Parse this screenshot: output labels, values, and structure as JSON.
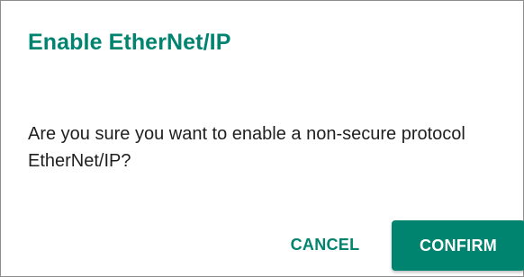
{
  "dialog": {
    "title": "Enable EtherNet/IP",
    "message": "Are you sure you want to enable a non-secure protocol EtherNet/IP?",
    "cancel_label": "CANCEL",
    "confirm_label": "CONFIRM"
  },
  "colors": {
    "accent": "#00836f",
    "text": "#1f1f1f",
    "border": "#8c8c8c",
    "background": "#ffffff"
  }
}
